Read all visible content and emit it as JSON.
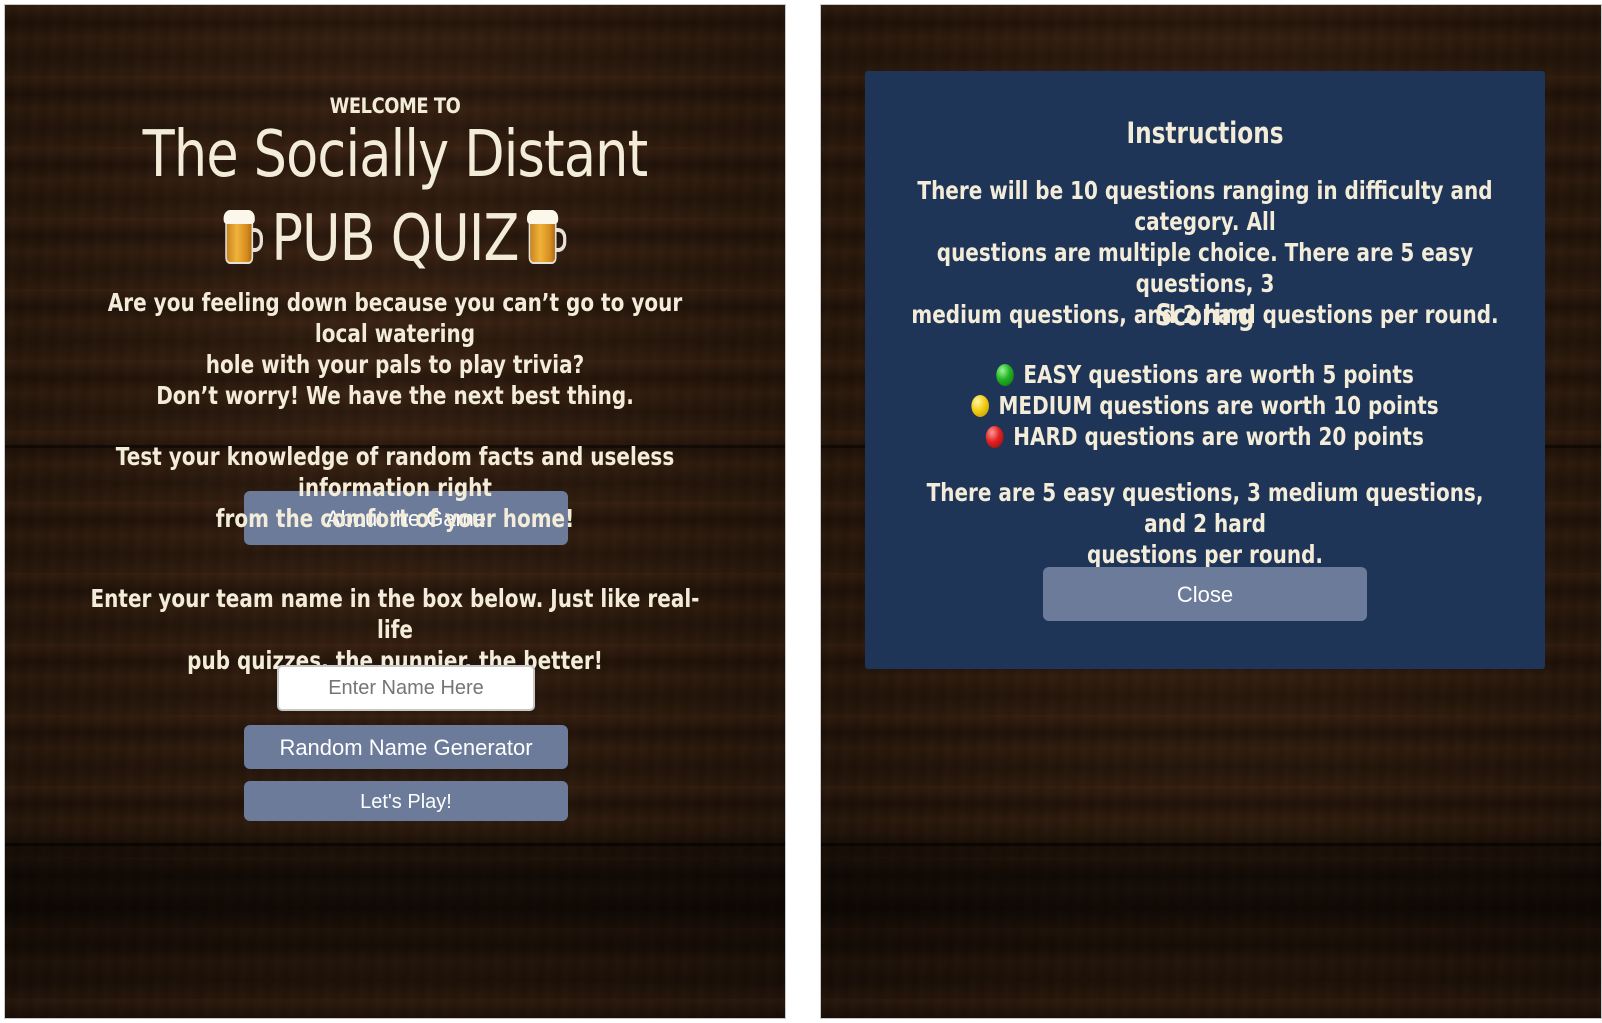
{
  "welcome_screen": {
    "welcome_label": "WELCOME TO",
    "title_line1": "The Socially Distant",
    "title_line2": "PUB QUIZ",
    "intro_line1": "Are you feeling down because you can’t go to your local watering",
    "intro_line2": "hole with your pals to play trivia?",
    "intro_line3": "Don’t worry! We have the next best thing.",
    "intro_line4": "Test your knowledge of random facts and useless information right",
    "intro_line5": "from the comfort of your home!",
    "about_button": "About the Game",
    "team_prompt_line1": "Enter your team name in the box below. Just like real-life",
    "team_prompt_line2": "pub quizzes, the punnier, the better!",
    "name_placeholder": "Enter Name Here",
    "random_name_button": "Random Name Generator",
    "play_button": "Let's Play!",
    "icons": [
      "beer-mug-icon",
      "beer-mug-icon"
    ]
  },
  "instructions_modal": {
    "heading": "Instructions",
    "instructions_line1": "There will be 10 questions ranging in difficulty and category. All",
    "instructions_line2": "questions are multiple choice. There are 5 easy questions, 3",
    "instructions_line3": "medium questions, and 2 hard questions per round.",
    "scoring_heading": "Scoring",
    "scoring": [
      {
        "text": "EASY questions are worth 5 points",
        "icon": "green-circle-icon",
        "color": "#22b222"
      },
      {
        "text": "MEDIUM questions are worth 10 points",
        "icon": "yellow-circle-icon",
        "color": "#f2cc12"
      },
      {
        "text": "HARD questions are worth 20 points",
        "icon": "red-circle-icon",
        "color": "#e32020"
      }
    ],
    "rounds_line1": "There are 5 easy questions, 3 medium questions, and 2 hard",
    "rounds_line2": "questions per round.",
    "close_button": "Close",
    "background_color": "#1f3557"
  },
  "colors": {
    "button": "#6b7b99",
    "text_cream": "#f3ecd9",
    "wood": "#2a1a10"
  }
}
